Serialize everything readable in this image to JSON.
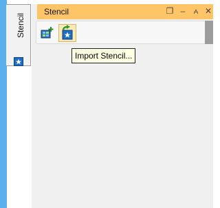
{
  "side_tab": {
    "label": "Stencil",
    "icon": "stencil-icon"
  },
  "panel": {
    "title": "Stencil",
    "controls": [
      {
        "icon": "restore-window-icon",
        "glyph": "❐"
      },
      {
        "icon": "minimize-icon",
        "glyph": "–"
      },
      {
        "icon": "pin-icon",
        "glyph": "⩜"
      },
      {
        "icon": "close-icon",
        "glyph": "✕"
      }
    ]
  },
  "toolbar": {
    "buttons": [
      {
        "icon": "new-stencil-icon"
      },
      {
        "icon": "import-stencil-icon"
      }
    ]
  },
  "tooltip": {
    "text": "Import Stencil..."
  },
  "colors": {
    "accent_strip": "#5ab0ec",
    "title_bar": "#fdc568",
    "hover_button": "#fde9b5",
    "tooltip_bg": "#ffffe4"
  }
}
